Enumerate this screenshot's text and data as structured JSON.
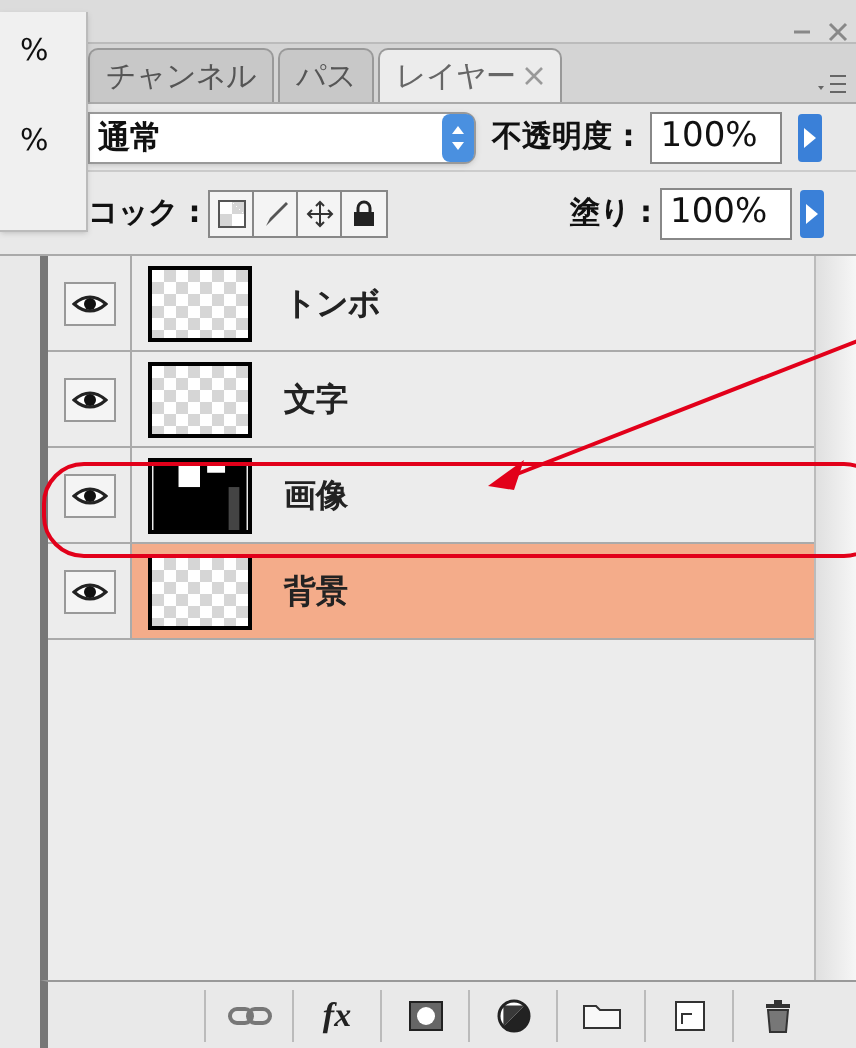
{
  "side_popup": {
    "values": [
      "%",
      "%"
    ]
  },
  "tabs": [
    {
      "label": "チャンネル",
      "selected": false
    },
    {
      "label": "パス",
      "selected": false
    },
    {
      "label": "レイヤー",
      "selected": true,
      "closable": true
    }
  ],
  "blend_mode": {
    "value": "通常"
  },
  "opacity": {
    "label": "不透明度 :",
    "value": "100%"
  },
  "lock": {
    "label": "コック :"
  },
  "fill": {
    "label": "塗り :",
    "value": "100%"
  },
  "layers": [
    {
      "name": "トンボ",
      "visible": true,
      "selected": false,
      "kind": "transparent"
    },
    {
      "name": "文字",
      "visible": true,
      "selected": false,
      "kind": "transparent"
    },
    {
      "name": "画像",
      "visible": true,
      "selected": false,
      "kind": "image"
    },
    {
      "name": "背景",
      "visible": true,
      "selected": true,
      "kind": "transparent"
    }
  ],
  "toolbar": [
    {
      "kind": "link"
    },
    {
      "kind": "fx",
      "label": "fx"
    },
    {
      "kind": "mask"
    },
    {
      "kind": "adjust"
    },
    {
      "kind": "folder"
    },
    {
      "kind": "new"
    },
    {
      "kind": "trash"
    }
  ]
}
